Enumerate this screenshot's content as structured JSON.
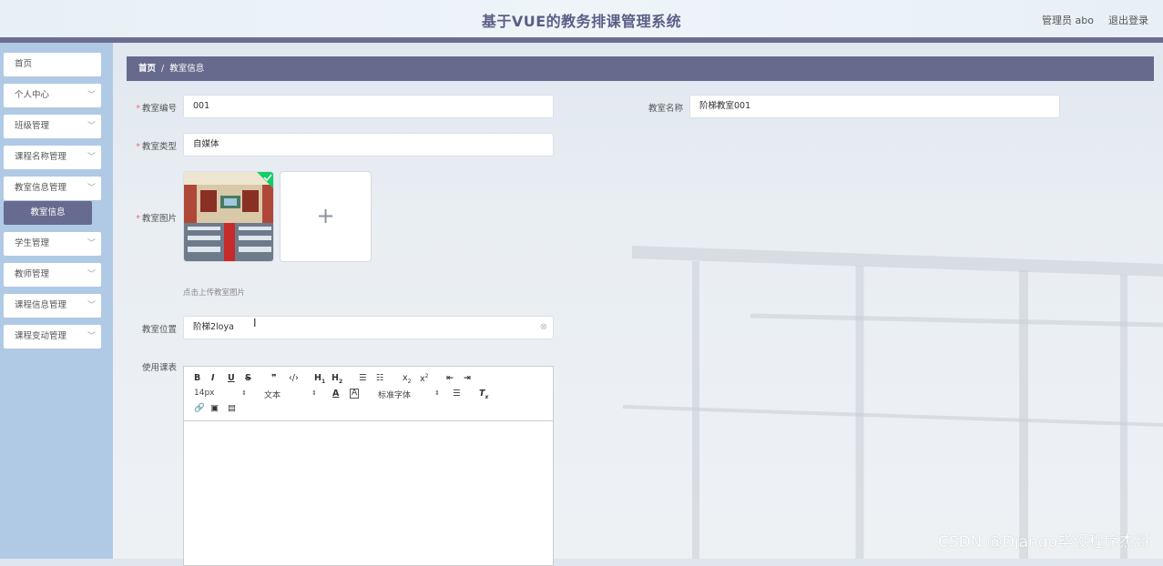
{
  "header": {
    "title": "基于VUE的教务排课管理系统",
    "user": "管理员 abo",
    "logout": "退出登录"
  },
  "sidebar": {
    "items": [
      {
        "label": "首页",
        "has_chevron": false
      },
      {
        "label": "个人中心",
        "has_chevron": true
      },
      {
        "label": "班级管理",
        "has_chevron": true
      },
      {
        "label": "课程名称管理",
        "has_chevron": true
      },
      {
        "label": "教室信息管理",
        "has_chevron": true
      },
      {
        "label": "学生管理",
        "has_chevron": true
      },
      {
        "label": "教师管理",
        "has_chevron": true
      },
      {
        "label": "课程信息管理",
        "has_chevron": true
      },
      {
        "label": "课程变动管理",
        "has_chevron": true
      }
    ],
    "active_sub": "教室信息"
  },
  "breadcrumb": {
    "home": "首页",
    "separator": "/",
    "current": "教室信息"
  },
  "form": {
    "room_no": {
      "label": "教室编号",
      "value": "001",
      "required": true
    },
    "room_name": {
      "label": "教室名称",
      "value": "阶梯教室001",
      "required": false
    },
    "room_type": {
      "label": "教室类型",
      "value": "自媒体",
      "required": true
    },
    "room_image": {
      "label": "教室图片",
      "required": true,
      "hint": "点击上传教室图片",
      "add_icon": "plus-icon"
    },
    "room_location": {
      "label": "教室位置",
      "value": "阶梯2loya",
      "required": false
    },
    "schedule": {
      "label": "使用课表",
      "required": false
    }
  },
  "editor": {
    "font_size": "14px",
    "text_style": "文本",
    "font_family": "标准字体"
  },
  "watermark": "CSDN @Django毕设程序杰哥",
  "colors": {
    "accent": "#666a8d",
    "sidebar_bg": "#b0cae6",
    "required": "#f56c6c"
  }
}
